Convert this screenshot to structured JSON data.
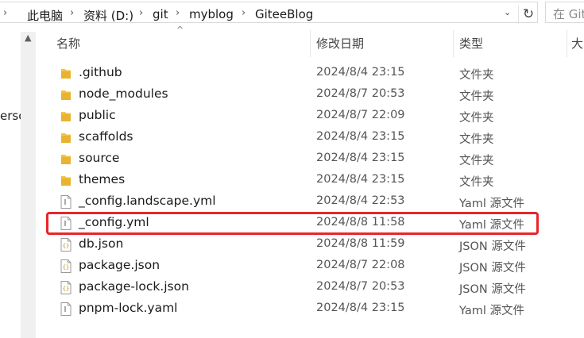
{
  "address_bar": {
    "crumbs": [
      "此电脑",
      "资料 (D:)",
      "git",
      "myblog",
      "GiteeBlog"
    ],
    "search_placeholder": "在 Git"
  },
  "nav": {
    "partial_item": "ersc"
  },
  "columns": {
    "name": "名称",
    "date": "修改日期",
    "type": "类型",
    "size": "大"
  },
  "files": [
    {
      "name": ".github",
      "date": "2024/8/4 23:15",
      "type": "文件夹",
      "icon": "folder-icon"
    },
    {
      "name": "node_modules",
      "date": "2024/8/7 20:53",
      "type": "文件夹",
      "icon": "folder-icon"
    },
    {
      "name": "public",
      "date": "2024/8/7 22:09",
      "type": "文件夹",
      "icon": "folder-icon"
    },
    {
      "name": "scaffolds",
      "date": "2024/8/4 23:15",
      "type": "文件夹",
      "icon": "folder-icon"
    },
    {
      "name": "source",
      "date": "2024/8/4 23:15",
      "type": "文件夹",
      "icon": "folder-icon"
    },
    {
      "name": "themes",
      "date": "2024/8/4 23:15",
      "type": "文件夹",
      "icon": "folder-icon"
    },
    {
      "name": "_config.landscape.yml",
      "date": "2024/8/4 22:53",
      "type": "Yaml 源文件",
      "icon": "yaml-file-icon"
    },
    {
      "name": "_config.yml",
      "date": "2024/8/8 11:58",
      "type": "Yaml 源文件",
      "icon": "yaml-file-icon"
    },
    {
      "name": "db.json",
      "date": "2024/8/8 11:59",
      "type": "JSON 源文件",
      "icon": "json-file-icon"
    },
    {
      "name": "package.json",
      "date": "2024/8/7 22:08",
      "type": "JSON 源文件",
      "icon": "json-file-icon"
    },
    {
      "name": "package-lock.json",
      "date": "2024/8/7 20:53",
      "type": "JSON 源文件",
      "icon": "json-file-icon"
    },
    {
      "name": "pnpm-lock.yaml",
      "date": "2024/8/4 23:15",
      "type": "Yaml 源文件",
      "icon": "yaml-file-icon"
    }
  ],
  "highlighted_file": "_config.yml",
  "colors": {
    "highlight_border": "#e8252a",
    "folder": "#f5c342",
    "folder_dark": "#dca625"
  }
}
